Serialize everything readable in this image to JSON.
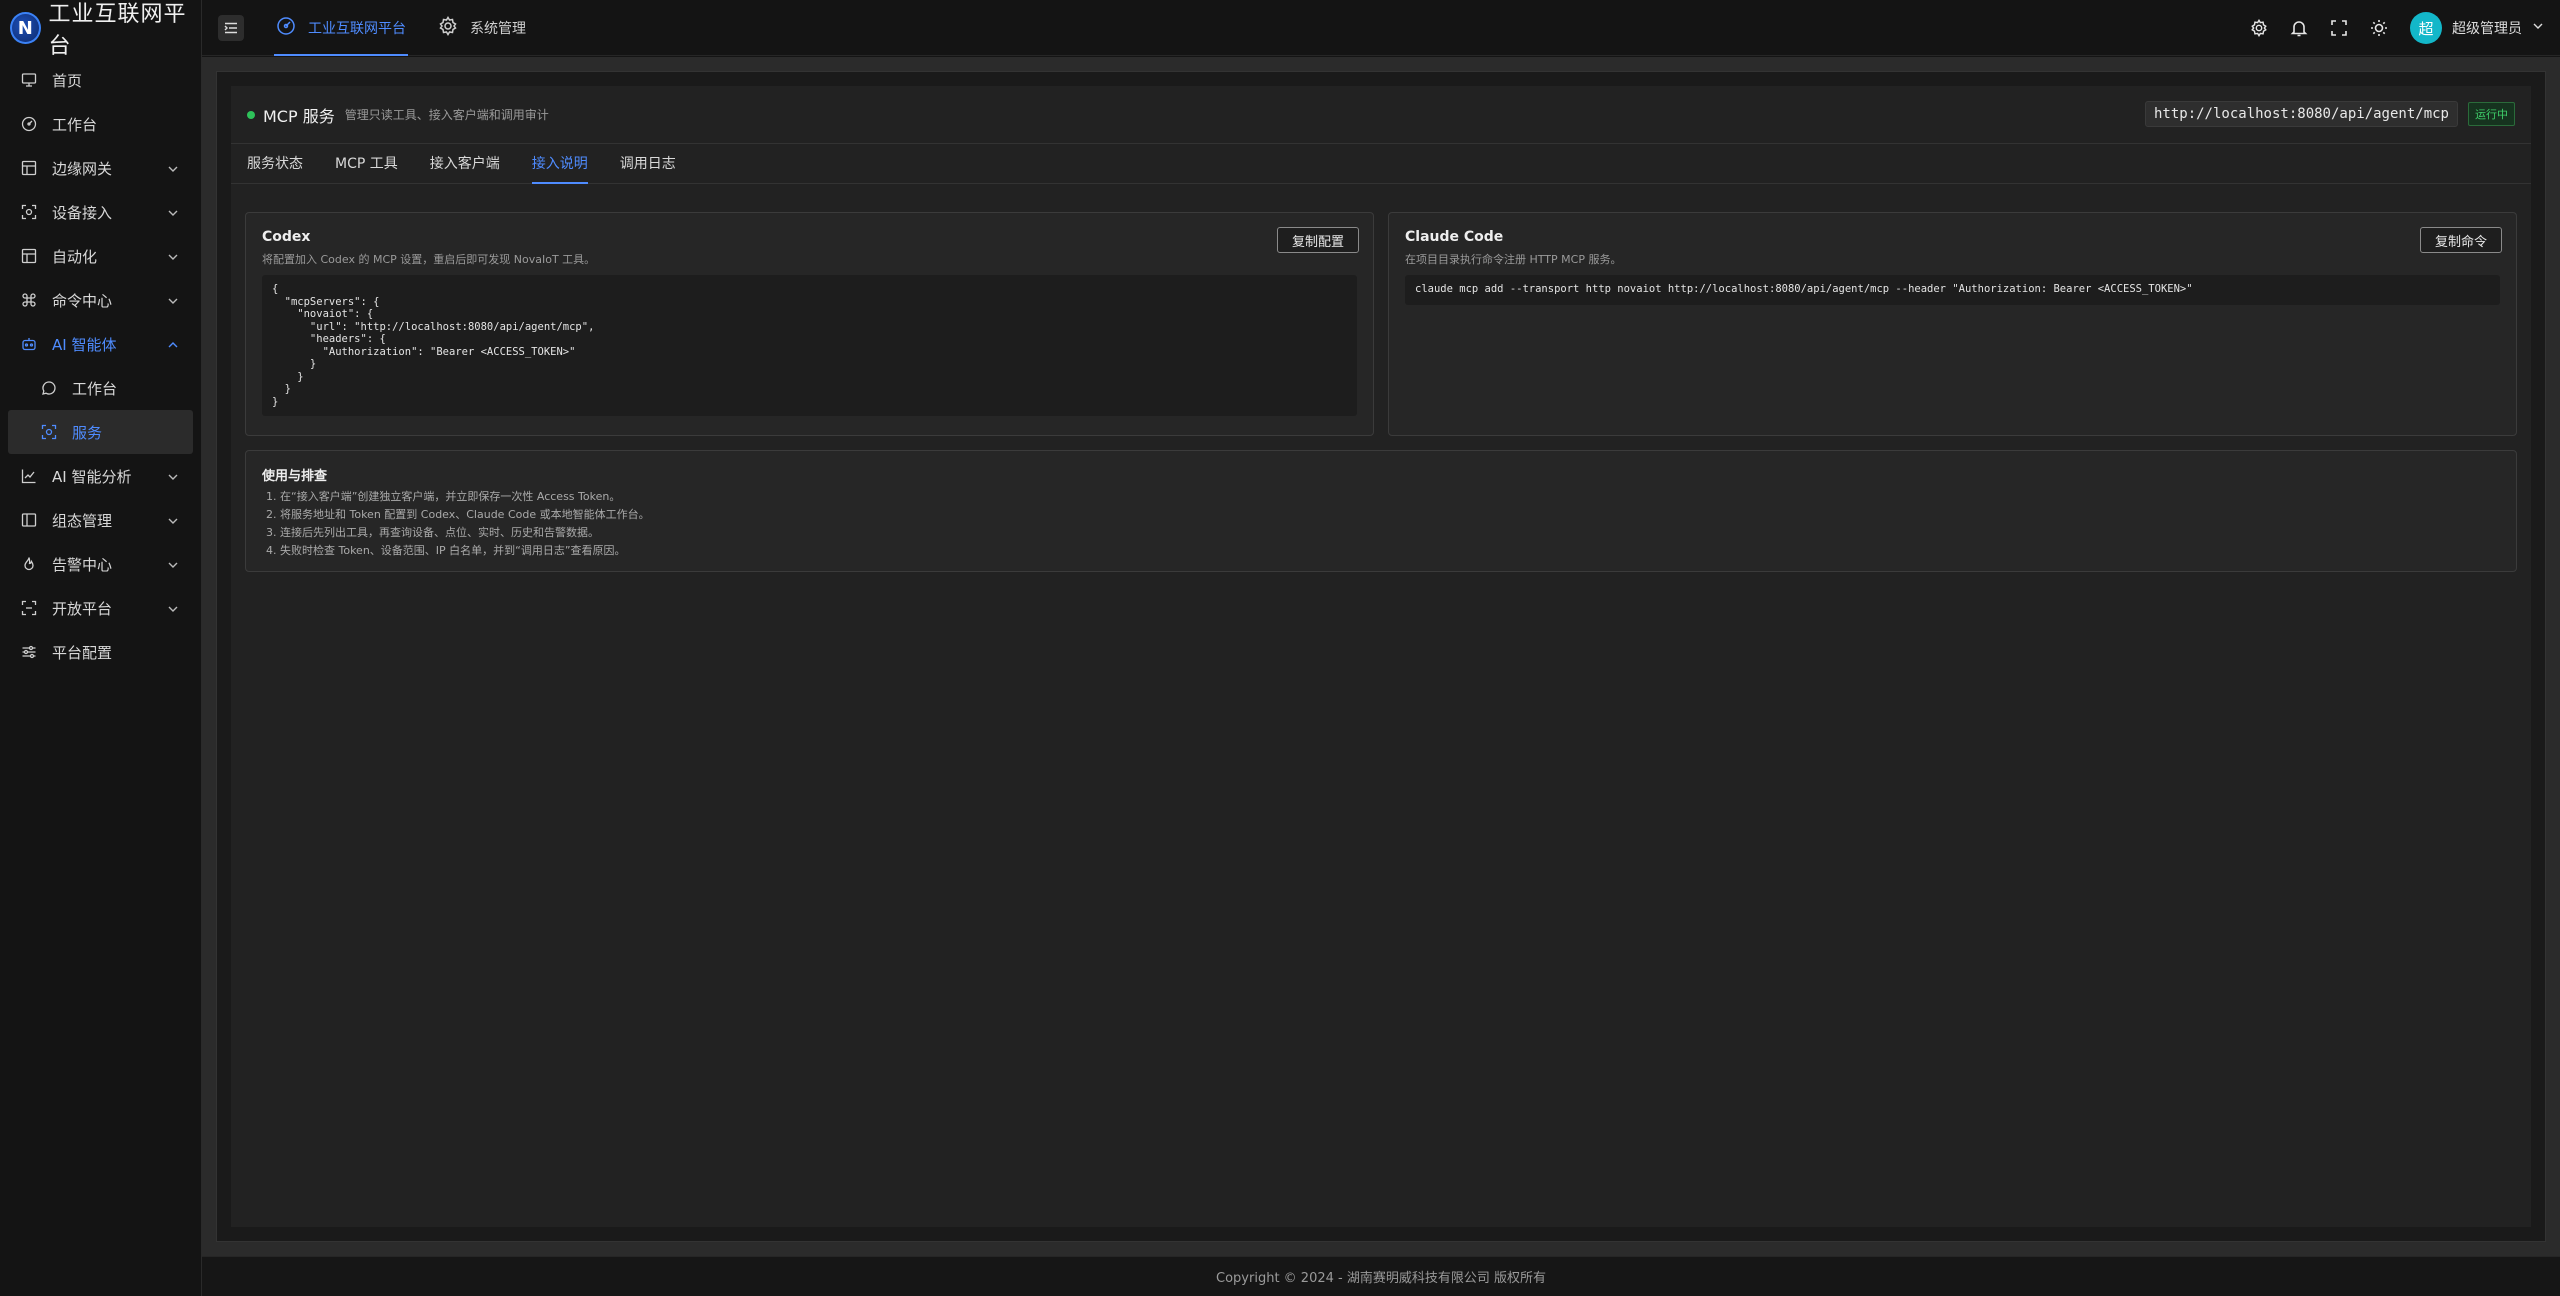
{
  "brand": {
    "logo_letter": "N",
    "title": "工业互联网平台"
  },
  "sidebar": {
    "items": [
      {
        "label": "首页",
        "icon": "monitor-icon"
      },
      {
        "label": "工作台",
        "icon": "dashboard-icon"
      },
      {
        "label": "边缘网关",
        "icon": "gateway-icon",
        "expandable": true
      },
      {
        "label": "设备接入",
        "icon": "device-scan-icon",
        "expandable": true
      },
      {
        "label": "自动化",
        "icon": "layout-icon",
        "expandable": true
      },
      {
        "label": "命令中心",
        "icon": "command-icon",
        "expandable": true
      },
      {
        "label": "AI 智能体",
        "icon": "robot-icon",
        "expandable": true,
        "expanded": true
      },
      {
        "label": "工作台",
        "icon": "chat-icon",
        "sub": true
      },
      {
        "label": "服务",
        "icon": "scan-icon",
        "sub": true,
        "active": true
      },
      {
        "label": "AI 智能分析",
        "icon": "line-chart-icon",
        "expandable": true
      },
      {
        "label": "组态管理",
        "icon": "panel-icon",
        "expandable": true
      },
      {
        "label": "告警中心",
        "icon": "fire-icon",
        "expandable": true
      },
      {
        "label": "开放平台",
        "icon": "api-icon",
        "expandable": true
      },
      {
        "label": "平台配置",
        "icon": "sliders-icon"
      }
    ]
  },
  "header": {
    "tabs": [
      {
        "label": "工业互联网平台",
        "active": true
      },
      {
        "label": "系统管理",
        "active": false
      }
    ],
    "avatar_text": "超",
    "user_name": "超级管理员"
  },
  "service": {
    "title": "MCP 服务",
    "subtitle": "管理只读工具、接入客户端和调用审计",
    "endpoint": "http://localhost:8080/api/agent/mcp",
    "status": "运行中",
    "tabs": [
      "服务状态",
      "MCP 工具",
      "接入客户端",
      "接入说明",
      "调用日志"
    ],
    "active_tab": 3
  },
  "codex": {
    "title": "Codex",
    "desc": "将配置加入 Codex 的 MCP 设置，重启后即可发现 NovaIoT 工具。",
    "button": "复制配置",
    "code": "{\n  \"mcpServers\": {\n    \"novaiot\": {\n      \"url\": \"http://localhost:8080/api/agent/mcp\",\n      \"headers\": {\n        \"Authorization\": \"Bearer <ACCESS_TOKEN>\"\n      }\n    }\n  }\n}"
  },
  "claude": {
    "title": "Claude Code",
    "desc": "在项目目录执行命令注册 HTTP MCP 服务。",
    "button": "复制命令",
    "command": "claude mcp add --transport http novaiot http://localhost:8080/api/agent/mcp --header \"Authorization: Bearer <ACCESS_TOKEN>\""
  },
  "usage": {
    "title": "使用与排查",
    "steps": [
      "1. 在“接入客户端”创建独立客户端，并立即保存一次性 Access Token。",
      "2. 将服务地址和 Token 配置到 Codex、Claude Code 或本地智能体工作台。",
      "3. 连接后先列出工具，再查询设备、点位、实时、历史和告警数据。",
      "4. 失败时检查 Token、设备范围、IP 白名单，并到“调用日志”查看原因。"
    ]
  },
  "footer": {
    "copyright": "Copyright © 2024 - 湖南赛明威科技有限公司 版权所有"
  },
  "colors": {
    "accent": "#4f8cff",
    "success": "#2ec25a",
    "avatar": "#13b7c9"
  }
}
